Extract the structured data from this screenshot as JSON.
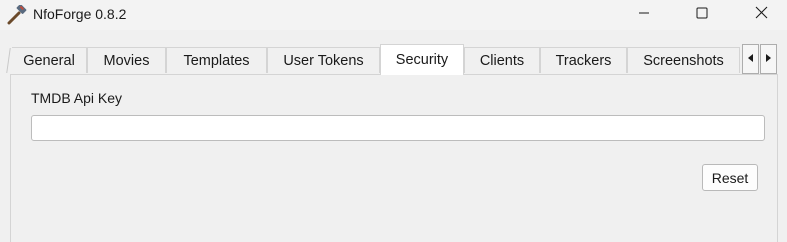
{
  "window": {
    "title": "NfoForge 0.8.2",
    "icon": "hammer-icon",
    "controls": {
      "minimize_icon": "minimize-icon",
      "maximize_icon": "maximize-icon",
      "close_icon": "close-icon"
    }
  },
  "tabs": [
    {
      "label": "General"
    },
    {
      "label": "Movies"
    },
    {
      "label": "Templates"
    },
    {
      "label": "User Tokens"
    },
    {
      "label": "Security",
      "active": true
    },
    {
      "label": "Clients"
    },
    {
      "label": "Trackers"
    },
    {
      "label": "Screenshots"
    }
  ],
  "tab_scroll": {
    "left_icon": "triangle-left-icon",
    "right_icon": "triangle-right-icon"
  },
  "security": {
    "tmdb_label": "TMDB Api Key",
    "tmdb_value": "",
    "tmdb_placeholder": "",
    "reset_label": "Reset"
  },
  "colors": {
    "window_bg": "#f0f0f0",
    "active_tab_bg": "#ffffff",
    "border": "#d4d4d4"
  }
}
